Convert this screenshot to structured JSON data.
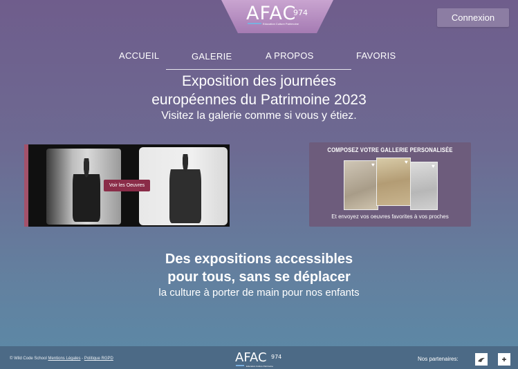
{
  "header": {
    "logo_text": "AFAC",
    "logo_number": "974",
    "logo_subtitle": "Education Culture Patrimoine",
    "login_label": "Connexion"
  },
  "nav": {
    "items": [
      {
        "label": "ACCUEIL"
      },
      {
        "label": "GALERIE"
      },
      {
        "label": "A PROPOS"
      },
      {
        "label": "FAVORIS"
      }
    ]
  },
  "hero": {
    "title_line1": "Exposition des journées",
    "title_line2": "européennes du Patrimoine 2023",
    "subtitle": "Visitez la galerie comme si vous y étiez."
  },
  "photo_card": {
    "button_label": "Voir les Oeuvres"
  },
  "gallery_card": {
    "title": "COMPOSEZ VOTRE GALLERIE PERSONALISÉE",
    "caption": "Et envoyez vos oeuvres favorites à vos proches"
  },
  "tagline": {
    "line1": "Des expositions accessibles",
    "line2": "pour tous, sans se déplacer",
    "line3": "la culture à porter de main pour nos enfants"
  },
  "footer": {
    "copyright": "© Wild Code School",
    "legal_link": "Mentions Légales",
    "separator": "-",
    "privacy_link": "Politique RGPD",
    "logo_text": "AFAC",
    "logo_number": "974",
    "logo_subtitle": "Education Culture Patrimoine",
    "partners_label": "Nos partenaires:"
  },
  "colors": {
    "accent": "#a3526b",
    "button": "#8a2c48",
    "footer_bg": "#4c6a86"
  }
}
